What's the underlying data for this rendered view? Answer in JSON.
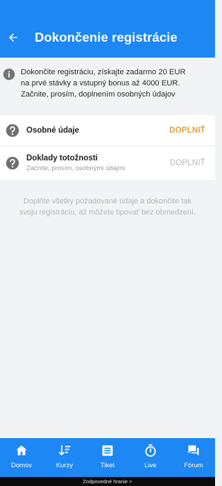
{
  "header": {
    "title": "Dokončenie registrácie",
    "back_icon": "arrow-left-icon"
  },
  "info": {
    "icon": "info-icon",
    "line1": "Dokončite registráciu, získajte zadarmo 20 EUR",
    "line2": "na prvé stávky a vstupný bonus až 4000 EUR.",
    "line3": "Začnite, prosím, doplnením osobných údajov"
  },
  "items": [
    {
      "title": "Osobné údaje",
      "subtitle": "",
      "action": "DOPLNIŤ",
      "icon": "question-icon",
      "action_color": "#e0a23a"
    },
    {
      "title": "Doklady totožnosti",
      "subtitle": "Začnite, prosím, osobnými údajmi",
      "action": "DOPLNIŤ",
      "icon": "question-icon",
      "action_color": "#b6b6b6"
    }
  ],
  "note": {
    "line1": "Doplňte všetky požadované údaje a dokončite tak",
    "line2": "svoju registráciu, až môžete tipovať bez obmedzení."
  },
  "tabs": [
    {
      "label": "Domov",
      "icon": "home-icon"
    },
    {
      "label": "Kurzy",
      "icon": "odds-icon"
    },
    {
      "label": "Tiket",
      "icon": "ticket-icon"
    },
    {
      "label": "Live",
      "icon": "stopwatch-icon"
    },
    {
      "label": "Fórum",
      "icon": "chat-icon"
    }
  ],
  "footer": {
    "text": "Zodpovedné hranie >"
  },
  "colors": {
    "primary": "#1d87f3",
    "accent": "#e0a23a",
    "background": "#f2f3f5"
  }
}
